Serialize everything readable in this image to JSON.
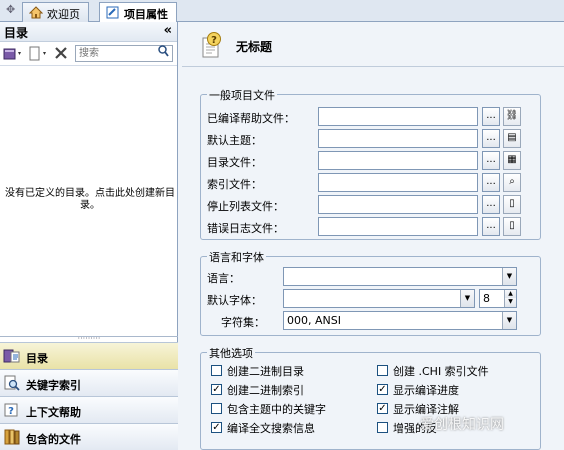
{
  "tabs": [
    {
      "label": "欢迎页",
      "active": false
    },
    {
      "label": "项目属性",
      "active": true
    }
  ],
  "left_panel": {
    "title": "目录",
    "collapse_glyph": "«",
    "search_placeholder": "搜索",
    "empty_message": "没有已定义的目录。点击此处创建新目录。",
    "nav_items": [
      {
        "label": "目录",
        "icon": "toc-icon",
        "selected": true
      },
      {
        "label": "关键字索引",
        "icon": "index-icon",
        "selected": false
      },
      {
        "label": "上下文帮助",
        "icon": "context-help-icon",
        "selected": false
      },
      {
        "label": "包含的文件",
        "icon": "included-files-icon",
        "selected": false
      }
    ]
  },
  "page": {
    "title": "无标题"
  },
  "general": {
    "title": "一般项目文件",
    "rows": [
      {
        "label": "已编译帮助文件：",
        "value": "",
        "browse": "...",
        "action_icon": "link-icon"
      },
      {
        "label": "默认主题：",
        "value": "",
        "browse": "...",
        "action_icon": "topic-icon"
      },
      {
        "label": "目录文件：",
        "value": "",
        "browse": "...",
        "action_icon": "toc-file-icon"
      },
      {
        "label": "索引文件：",
        "value": "",
        "browse": "...",
        "action_icon": "index-file-icon"
      },
      {
        "label": "停止列表文件：",
        "value": "",
        "browse": "...",
        "action_icon": "document-icon"
      },
      {
        "label": "错误日志文件：",
        "value": "",
        "browse": "...",
        "action_icon": "document-icon"
      }
    ]
  },
  "language": {
    "title": "语言和字体",
    "language_label": "语言：",
    "language_value": "",
    "font_label": "默认字体：",
    "font_value": "",
    "font_size": "8",
    "charset_label": "字符集：",
    "charset_value": "000, ANSI"
  },
  "other": {
    "title": "其他选项",
    "options": [
      {
        "label": "创建二进制目录",
        "checked": false
      },
      {
        "label": "创建 .CHI 索引文件",
        "checked": false
      },
      {
        "label": "创建二进制索引",
        "checked": true
      },
      {
        "label": "显示编译进度",
        "checked": true
      },
      {
        "label": "包含主题中的关键字",
        "checked": false
      },
      {
        "label": "显示编译注解",
        "checked": true
      },
      {
        "label": "编译全文搜索信息",
        "checked": true
      },
      {
        "label": "增强的反",
        "checked": false
      }
    ]
  },
  "watermark": "爱创根知识网",
  "colors": {
    "accent": "#8ea3bf",
    "selected_nav": "#e9e2a7",
    "background": "#f0f4f9"
  }
}
